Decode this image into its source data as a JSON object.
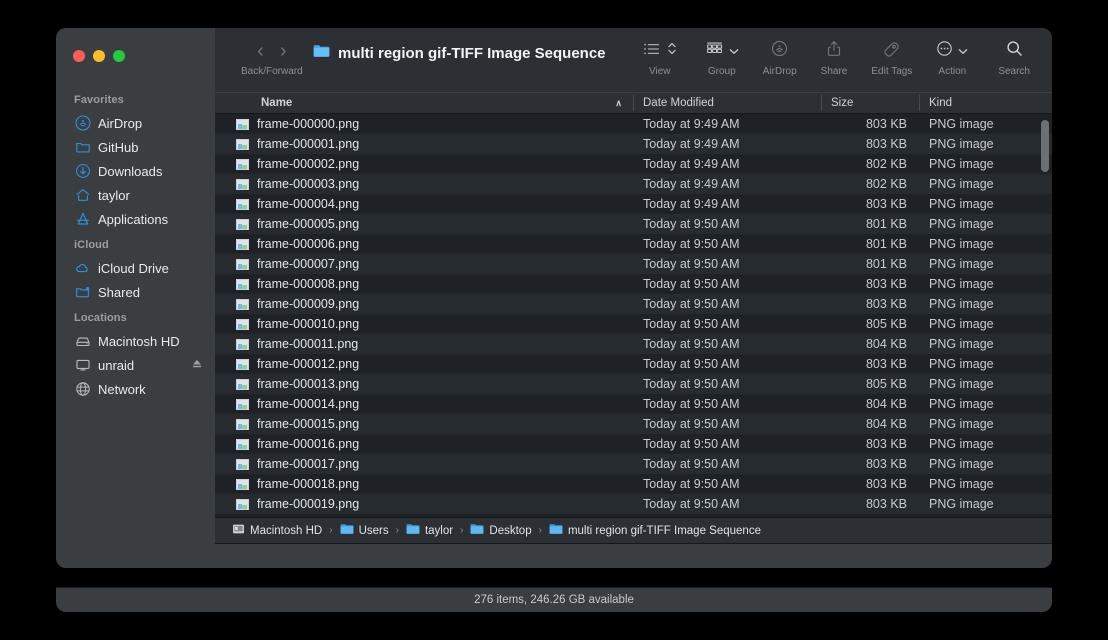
{
  "window": {
    "traffic_lights": [
      {
        "name": "close",
        "color": "#ff5f57"
      },
      {
        "name": "minimize",
        "color": "#febc2e"
      },
      {
        "name": "zoom",
        "color": "#28c840"
      }
    ]
  },
  "sidebar": {
    "sections": [
      {
        "title": "Favorites",
        "items": [
          {
            "label": "AirDrop",
            "icon": "airdrop-icon"
          },
          {
            "label": "GitHub",
            "icon": "folder-icon"
          },
          {
            "label": "Downloads",
            "icon": "download-icon"
          },
          {
            "label": "taylor",
            "icon": "home-icon"
          },
          {
            "label": "Applications",
            "icon": "applications-icon"
          }
        ]
      },
      {
        "title": "iCloud",
        "items": [
          {
            "label": "iCloud Drive",
            "icon": "cloud-icon"
          },
          {
            "label": "Shared",
            "icon": "shared-folder-icon"
          }
        ]
      },
      {
        "title": "Locations",
        "items": [
          {
            "label": "Macintosh HD",
            "icon": "harddisk-icon"
          },
          {
            "label": "unraid",
            "icon": "display-icon",
            "eject": true
          },
          {
            "label": "Network",
            "icon": "globe-icon"
          }
        ]
      }
    ]
  },
  "toolbar": {
    "nav_label": "Back/Forward",
    "back_glyph": "‹",
    "forward_glyph": "›",
    "title": "multi region gif-TIFF Image Sequence",
    "title_icon": "folder-icon",
    "buttons": [
      {
        "id": "view",
        "label": "View",
        "icon": "list-view-icon",
        "has_chevron": true
      },
      {
        "id": "group",
        "label": "Group",
        "icon": "group-icon",
        "has_chevron": true
      },
      {
        "id": "airdrop",
        "label": "AirDrop",
        "icon": "airdrop-icon",
        "has_chevron": false
      },
      {
        "id": "share",
        "label": "Share",
        "icon": "share-icon",
        "has_chevron": false
      },
      {
        "id": "edit_tags",
        "label": "Edit Tags",
        "icon": "tag-icon",
        "has_chevron": false
      },
      {
        "id": "action",
        "label": "Action",
        "icon": "ellipsis-circle-icon",
        "has_chevron": true
      },
      {
        "id": "search",
        "label": "Search",
        "icon": "search-icon",
        "has_chevron": false
      }
    ]
  },
  "columns": {
    "name": "Name",
    "date_modified": "Date Modified",
    "size": "Size",
    "kind": "Kind",
    "sort_arrow": "∧"
  },
  "files": [
    {
      "name": "frame-000000.png",
      "date": "Today at 9:49 AM",
      "size": "803 KB",
      "kind": "PNG image"
    },
    {
      "name": "frame-000001.png",
      "date": "Today at 9:49 AM",
      "size": "803 KB",
      "kind": "PNG image"
    },
    {
      "name": "frame-000002.png",
      "date": "Today at 9:49 AM",
      "size": "802 KB",
      "kind": "PNG image"
    },
    {
      "name": "frame-000003.png",
      "date": "Today at 9:49 AM",
      "size": "802 KB",
      "kind": "PNG image"
    },
    {
      "name": "frame-000004.png",
      "date": "Today at 9:49 AM",
      "size": "803 KB",
      "kind": "PNG image"
    },
    {
      "name": "frame-000005.png",
      "date": "Today at 9:50 AM",
      "size": "801 KB",
      "kind": "PNG image"
    },
    {
      "name": "frame-000006.png",
      "date": "Today at 9:50 AM",
      "size": "801 KB",
      "kind": "PNG image"
    },
    {
      "name": "frame-000007.png",
      "date": "Today at 9:50 AM",
      "size": "801 KB",
      "kind": "PNG image"
    },
    {
      "name": "frame-000008.png",
      "date": "Today at 9:50 AM",
      "size": "803 KB",
      "kind": "PNG image"
    },
    {
      "name": "frame-000009.png",
      "date": "Today at 9:50 AM",
      "size": "803 KB",
      "kind": "PNG image"
    },
    {
      "name": "frame-000010.png",
      "date": "Today at 9:50 AM",
      "size": "805 KB",
      "kind": "PNG image"
    },
    {
      "name": "frame-000011.png",
      "date": "Today at 9:50 AM",
      "size": "804 KB",
      "kind": "PNG image"
    },
    {
      "name": "frame-000012.png",
      "date": "Today at 9:50 AM",
      "size": "803 KB",
      "kind": "PNG image"
    },
    {
      "name": "frame-000013.png",
      "date": "Today at 9:50 AM",
      "size": "805 KB",
      "kind": "PNG image"
    },
    {
      "name": "frame-000014.png",
      "date": "Today at 9:50 AM",
      "size": "804 KB",
      "kind": "PNG image"
    },
    {
      "name": "frame-000015.png",
      "date": "Today at 9:50 AM",
      "size": "804 KB",
      "kind": "PNG image"
    },
    {
      "name": "frame-000016.png",
      "date": "Today at 9:50 AM",
      "size": "803 KB",
      "kind": "PNG image"
    },
    {
      "name": "frame-000017.png",
      "date": "Today at 9:50 AM",
      "size": "803 KB",
      "kind": "PNG image"
    },
    {
      "name": "frame-000018.png",
      "date": "Today at 9:50 AM",
      "size": "803 KB",
      "kind": "PNG image"
    },
    {
      "name": "frame-000019.png",
      "date": "Today at 9:50 AM",
      "size": "803 KB",
      "kind": "PNG image"
    }
  ],
  "path_bar": {
    "separator": "›",
    "crumbs": [
      {
        "label": "Macintosh HD",
        "icon": "harddisk-icon"
      },
      {
        "label": "Users",
        "icon": "users-folder-icon"
      },
      {
        "label": "taylor",
        "icon": "home-folder-icon"
      },
      {
        "label": "Desktop",
        "icon": "desktop-folder-icon"
      },
      {
        "label": "multi region gif-TIFF Image Sequence",
        "icon": "folder-icon"
      }
    ]
  },
  "status_bar": {
    "text": "276 items, 246.26 GB available"
  }
}
